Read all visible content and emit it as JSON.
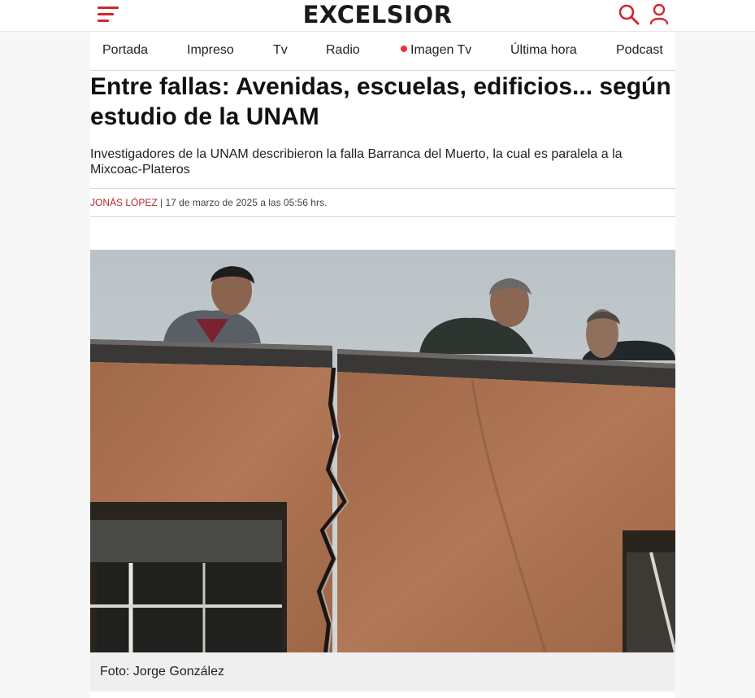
{
  "header": {
    "logo": "EXCELSIOR",
    "menu_icon": "hamburger-menu-icon",
    "search_icon": "search-icon",
    "user_icon": "user-icon",
    "accent_color": "#d0282f"
  },
  "nav": {
    "items": [
      "Portada",
      "Impreso",
      "Tv",
      "Radio",
      "Imagen Tv",
      "Última hora",
      "Podcast"
    ],
    "live_dot_color": "#e8343c"
  },
  "article": {
    "headline": "Entre fallas: Avenidas, escuelas, edificios... según estudio de la UNAM",
    "summary": "Investigadores de la UNAM describieron la falla Barranca del Muerto, la cual es paralela a la Mixcoac-Plateros",
    "author": "JONÁS LÓPEZ",
    "separator": " | ",
    "date": "17 de marzo de 2025 a las 05:56 hrs.",
    "photo_caption": "Foto: Jorge González"
  }
}
